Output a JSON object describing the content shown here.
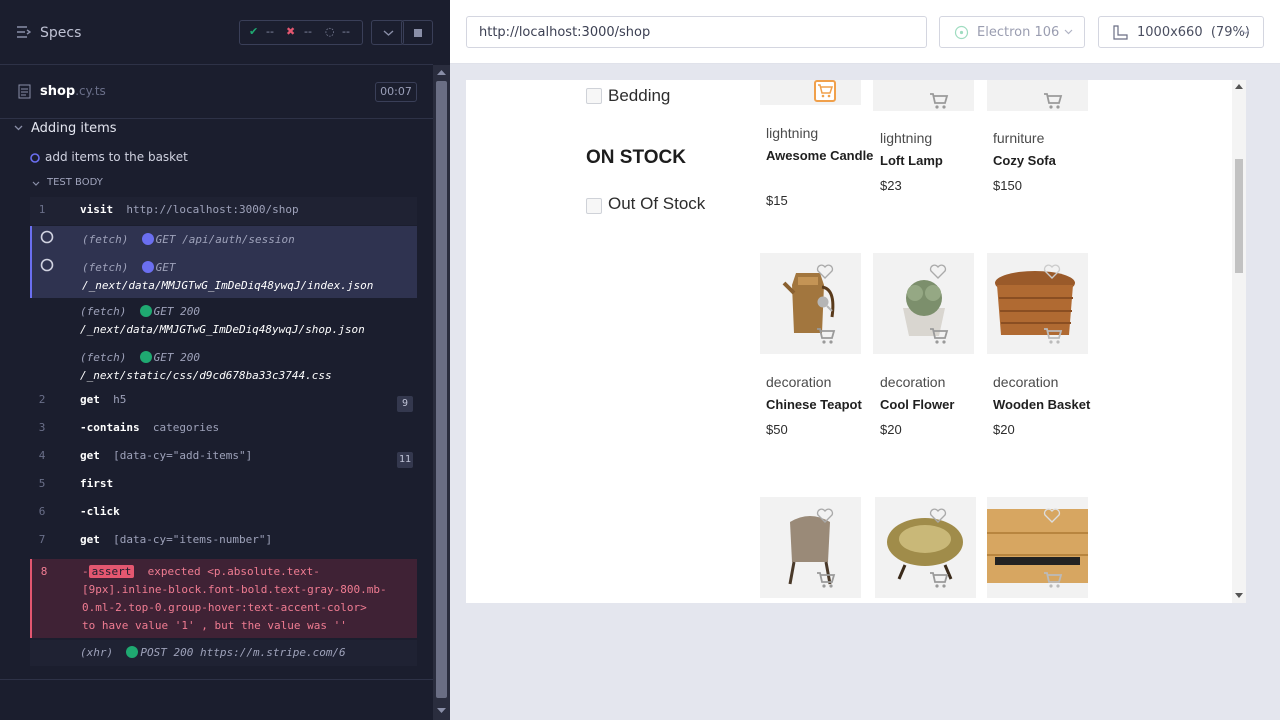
{
  "runner": {
    "specs_label": "Specs",
    "stats": {
      "passed": "--",
      "failed": "--",
      "pending": "--"
    },
    "spec": {
      "name": "shop",
      "ext": ".cy.ts",
      "timer": "00:07"
    },
    "suite": "Adding items",
    "test": "add items to the basket",
    "section": "TEST BODY",
    "commands": [
      {
        "num": "1",
        "name": "visit",
        "msg": "http://localhost:3000/shop"
      },
      {
        "method": "(fetch)",
        "status": "GET",
        "path": "/api/auth/session"
      },
      {
        "method": "(fetch)",
        "status": "GET",
        "path": "/_next/data/MMJGTwG_ImDeDiq48ywqJ/index.json"
      },
      {
        "method": "(fetch)",
        "status": "GET 200",
        "path": "/_next/data/MMJGTwG_ImDeDiq48ywqJ/shop.json"
      },
      {
        "method": "(fetch)",
        "status": "GET 200",
        "path": "/_next/static/css/d9cd678ba33c3744.css"
      },
      {
        "num": "2",
        "name": "get",
        "msg": "h5",
        "badge": "9"
      },
      {
        "num": "3",
        "name": "-contains",
        "msg": "categories"
      },
      {
        "num": "4",
        "name": "get",
        "msg": "[data-cy=\"add-items\"]",
        "badge": "11"
      },
      {
        "num": "5",
        "name": "first",
        "msg": ""
      },
      {
        "num": "6",
        "name": "-click",
        "msg": ""
      },
      {
        "num": "7",
        "name": "get",
        "msg": "[data-cy=\"items-number\"]"
      },
      {
        "num": "8",
        "name": "-",
        "tag": "assert",
        "line1": "expected  <p.absolute.text-",
        "line2": "[9px].inline-block.font-bold.text-gray-800.mb-",
        "line3": "0.ml-2.top-0.group-hover:text-accent-color>",
        "line4": "to have value  '1' , but the value was  ''"
      },
      {
        "method": "(xhr)",
        "status": "POST 200",
        "path": "https://m.stripe.com/6"
      }
    ]
  },
  "browser": {
    "url": "http://localhost:3000/shop",
    "engine": "Electron 106",
    "viewport": "1000x660",
    "zoom": "(79%)"
  },
  "shop": {
    "filter_bedding": "Bedding",
    "stock_heading": "ON STOCK",
    "filter_out_of_stock": "Out Of Stock",
    "products_row1": [
      {
        "category": "lightning",
        "name": "Awesome Candle",
        "price": "$15"
      },
      {
        "category": "lightning",
        "name": "Loft Lamp",
        "price": "$23"
      },
      {
        "category": "furniture",
        "name": "Cozy Sofa",
        "price": "$150"
      }
    ],
    "products_row2": [
      {
        "category": "decoration",
        "name": "Chinese Teapot",
        "price": "$50"
      },
      {
        "category": "decoration",
        "name": "Cool Flower",
        "price": "$20"
      },
      {
        "category": "decoration",
        "name": "Wooden Basket",
        "price": "$20"
      }
    ]
  },
  "colors": {
    "pending": "#6b6ff0",
    "success": "#1fa971",
    "error": "#e45770"
  }
}
